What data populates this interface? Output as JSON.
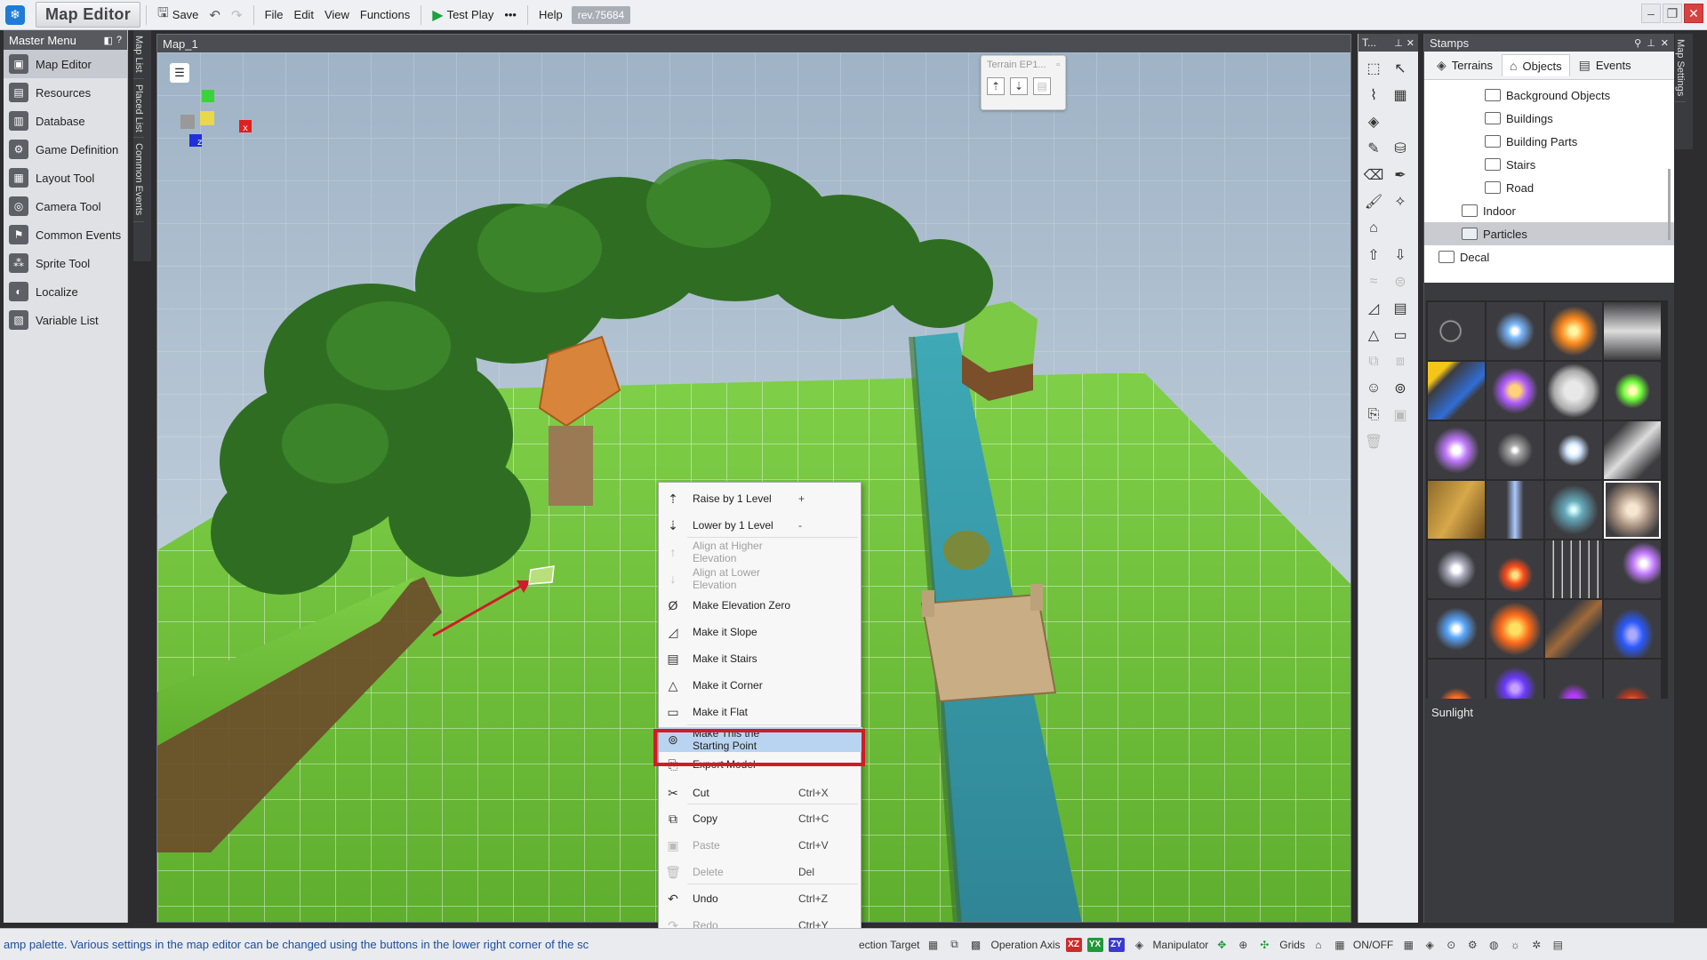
{
  "app": {
    "title": "Map Editor",
    "revision": "rev.75684"
  },
  "toolbar": {
    "save": "Save",
    "file": "File",
    "edit": "Edit",
    "view": "View",
    "functions": "Functions",
    "test_play": "Test Play",
    "more": "•••",
    "help": "Help"
  },
  "master_menu": {
    "title": "Master Menu",
    "items": [
      {
        "label": "Map Editor",
        "icon": "map-editor-icon"
      },
      {
        "label": "Resources",
        "icon": "resources-icon"
      },
      {
        "label": "Database",
        "icon": "database-icon"
      },
      {
        "label": "Game Definition",
        "icon": "game-definition-icon"
      },
      {
        "label": "Layout Tool",
        "icon": "layout-tool-icon"
      },
      {
        "label": "Camera Tool",
        "icon": "camera-tool-icon"
      },
      {
        "label": "Common Events",
        "icon": "common-events-icon"
      },
      {
        "label": "Sprite Tool",
        "icon": "sprite-tool-icon"
      },
      {
        "label": "Localize",
        "icon": "localize-icon"
      },
      {
        "label": "Variable List",
        "icon": "variable-list-icon"
      }
    ]
  },
  "left_vtabs": [
    "Map List",
    "Placed List",
    "Common Events"
  ],
  "viewport": {
    "tab": "Map_1",
    "terrain_palette_title": "Terrain EP1..."
  },
  "context_menu": {
    "items": [
      {
        "label": "Raise by 1 Level",
        "key": "+",
        "disabled": false
      },
      {
        "label": "Lower by 1 Level",
        "key": "-",
        "disabled": false
      },
      {
        "label": "Align at Higher Elevation",
        "key": "",
        "disabled": true
      },
      {
        "label": "Align at Lower Elevation",
        "key": "",
        "disabled": true
      },
      {
        "label": "Make Elevation Zero",
        "key": "",
        "disabled": false
      },
      {
        "label": "Make it Slope",
        "key": "",
        "disabled": false
      },
      {
        "label": "Make it Stairs",
        "key": "",
        "disabled": false
      },
      {
        "label": "Make it Corner",
        "key": "",
        "disabled": false
      },
      {
        "label": "Make it Flat",
        "key": "",
        "disabled": false
      },
      {
        "label": "Make This the Starting Point",
        "key": "",
        "disabled": false,
        "highlighted": true
      },
      {
        "label": "Export Model",
        "key": "",
        "disabled": false
      },
      {
        "label": "Cut",
        "key": "Ctrl+X",
        "disabled": false
      },
      {
        "label": "Copy",
        "key": "Ctrl+C",
        "disabled": false
      },
      {
        "label": "Paste",
        "key": "Ctrl+V",
        "disabled": true
      },
      {
        "label": "Delete",
        "key": "Del",
        "disabled": true
      },
      {
        "label": "Undo",
        "key": "Ctrl+Z",
        "disabled": false
      },
      {
        "label": "Redo",
        "key": "Ctrl+Y",
        "disabled": true
      }
    ]
  },
  "tools_panel": {
    "title": "T..."
  },
  "stamps": {
    "title": "Stamps",
    "tabs": [
      "Terrains",
      "Objects",
      "Events"
    ],
    "active_tab": "Objects",
    "tree": [
      {
        "label": "Background Objects",
        "level": 2
      },
      {
        "label": "Buildings",
        "level": 2
      },
      {
        "label": "Building Parts",
        "level": 2
      },
      {
        "label": "Stairs",
        "level": 2
      },
      {
        "label": "Road",
        "level": 2
      },
      {
        "label": "Indoor",
        "level": 1
      },
      {
        "label": "Particles",
        "level": 1,
        "selected": true
      },
      {
        "label": "Decal",
        "level": 0
      }
    ],
    "selected_item": "Sunlight"
  },
  "right_vtab": "Map Settings",
  "statusbar": {
    "message": "amp palette.  Various settings in the map editor can be changed using the buttons in the lower right corner of the sc",
    "selection_target": "ection Target",
    "operation_axis": "Operation Axis",
    "manipulator": "Manipulator",
    "grids": "Grids",
    "onoff": "ON/OFF",
    "axes": [
      "XZ",
      "YX",
      "ZY"
    ]
  },
  "colors": {
    "highlight_border": "#d11a2a",
    "menu_highlight": "#b9d4f0",
    "status_text": "#1d4fa0",
    "grass": "#6fc23a",
    "water": "#3a9aae"
  }
}
